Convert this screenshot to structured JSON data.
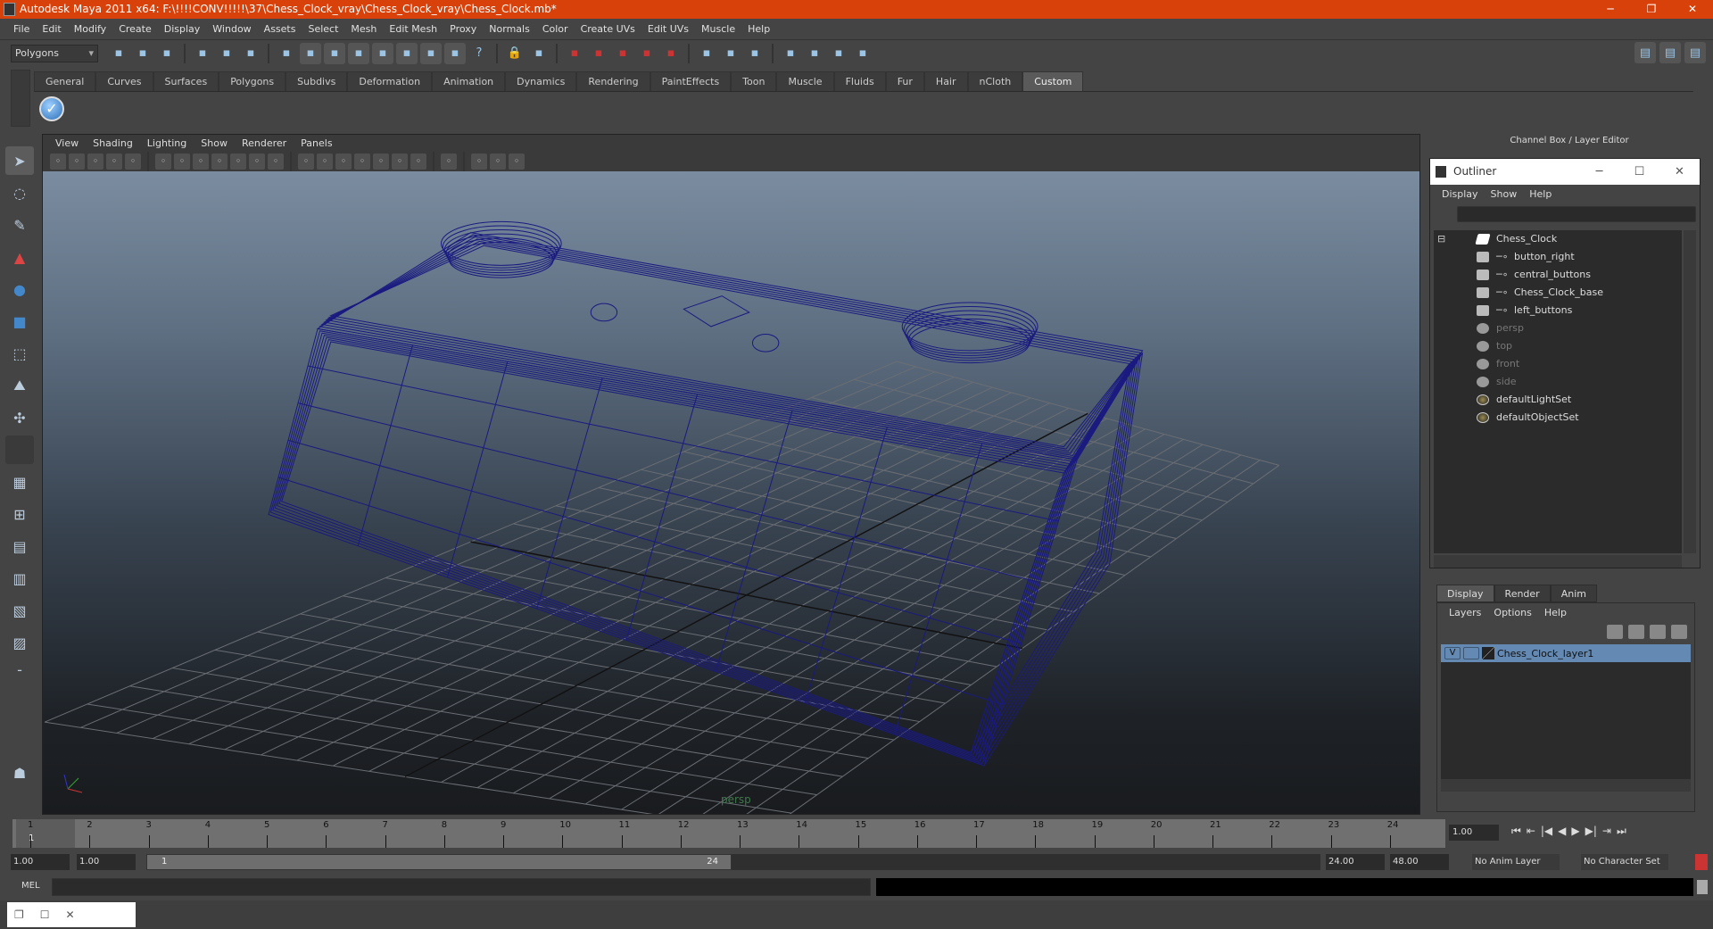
{
  "window": {
    "title": "Autodesk Maya 2011 x64: F:\\!!!!CONV!!!!!\\37\\Chess_Clock_vray\\Chess_Clock_vray\\Chess_Clock.mb*",
    "min": "─",
    "max": "❐",
    "close": "✕"
  },
  "menubar": [
    "File",
    "Edit",
    "Modify",
    "Create",
    "Display",
    "Window",
    "Assets",
    "Select",
    "Mesh",
    "Edit Mesh",
    "Proxy",
    "Normals",
    "Color",
    "Create UVs",
    "Edit UVs",
    "Muscle",
    "Help"
  ],
  "toolbar": {
    "mode": "Polygons",
    "icons": [
      "new-scene-icon",
      "open-scene-icon",
      "save-scene-icon",
      "|",
      "select-hierarchy-icon",
      "select-object-icon",
      "select-component-icon",
      "|",
      "lock-selection-icon",
      "snap-grid-icon",
      "snap-curve-icon",
      "snap-point-icon",
      "snap-view-plane-icon",
      "snap-live-icon",
      "snap-surface-icon",
      "snap-points-icon",
      "help-icon",
      "|",
      "lock-icon",
      "select-highlight-icon",
      "|",
      "magnet-grid-icon",
      "magnet-curve-icon",
      "magnet-point-icon",
      "magnet-plane-icon",
      "magnet-live-icon",
      "|",
      "input-ops-icon",
      "output-ops-icon",
      "history-icon",
      "|",
      "render-view-icon",
      "render-clapper-icon",
      "ipr-render-icon",
      "render-settings-icon"
    ],
    "right_icons": [
      "attribute-editor-icon",
      "tool-settings-icon",
      "channel-box-icon"
    ]
  },
  "shelf": {
    "tabs": [
      "General",
      "Curves",
      "Surfaces",
      "Polygons",
      "Subdivs",
      "Deformation",
      "Animation",
      "Dynamics",
      "Rendering",
      "PaintEffects",
      "Toon",
      "Muscle",
      "Fluids",
      "Fur",
      "Hair",
      "nCloth",
      "Custom"
    ],
    "active": "Custom"
  },
  "viewport": {
    "menus": [
      "View",
      "Shading",
      "Lighting",
      "Show",
      "Renderer",
      "Panels"
    ],
    "camera": "persp",
    "wire_color": "#1a1a80",
    "icons": [
      "camera-select-icon",
      "camera-attributes-icon",
      "bookmark-icon",
      "image-plane-icon",
      "two-d-pan-zoom-icon",
      "|",
      "grid-icon",
      "film-gate-icon",
      "resolution-gate-icon",
      "gate-mask-icon",
      "field-chart-icon",
      "safe-action-icon",
      "safe-title-icon",
      "|",
      "wireframe-icon",
      "smooth-shade-icon",
      "wireframe-on-shaded-icon",
      "textured-icon",
      "use-all-lights-icon",
      "shadows-icon",
      "default-material-icon",
      "|",
      "isolate-select-icon",
      "|",
      "xray-icon",
      "xray-joints-icon",
      "xray-components-icon"
    ]
  },
  "right_panel": {
    "header": "Channel Box / Layer Editor"
  },
  "outliner": {
    "title": "Outliner",
    "menus": [
      "Display",
      "Show",
      "Help"
    ],
    "items": [
      {
        "label": "Chess_Clock",
        "type": "group",
        "depth": 0,
        "dim": false
      },
      {
        "label": "button_right",
        "type": "mesh",
        "depth": 1,
        "dim": false
      },
      {
        "label": "central_buttons",
        "type": "mesh",
        "depth": 1,
        "dim": false
      },
      {
        "label": "Chess_Clock_base",
        "type": "mesh",
        "depth": 1,
        "dim": false
      },
      {
        "label": "left_buttons",
        "type": "mesh",
        "depth": 1,
        "dim": false
      },
      {
        "label": "persp",
        "type": "camera",
        "depth": 0,
        "dim": true
      },
      {
        "label": "top",
        "type": "camera",
        "depth": 0,
        "dim": true
      },
      {
        "label": "front",
        "type": "camera",
        "depth": 0,
        "dim": true
      },
      {
        "label": "side",
        "type": "camera",
        "depth": 0,
        "dim": true
      },
      {
        "label": "defaultLightSet",
        "type": "set",
        "depth": 0,
        "dim": false
      },
      {
        "label": "defaultObjectSet",
        "type": "set",
        "depth": 0,
        "dim": false
      }
    ]
  },
  "layer_editor": {
    "tabs": [
      "Display",
      "Render",
      "Anim"
    ],
    "active": "Display",
    "menus": [
      "Layers",
      "Options",
      "Help"
    ],
    "layer": {
      "visible": "V",
      "name": "Chess_Clock_layer1",
      "color": "#6489b2"
    }
  },
  "timeline": {
    "start": 1,
    "end": 24,
    "current_label": "1",
    "current_frame": "1.00"
  },
  "range": {
    "start": "1.00",
    "anim_start": "1.00",
    "slider_start": "1",
    "slider_end": "24",
    "end": "24.00",
    "anim_end": "48.00",
    "anim_layer": "No Anim Layer",
    "character_set": "No Character Set"
  },
  "playback": [
    "⏮",
    "⇤",
    "|◀",
    "◀",
    "▶",
    "▶|",
    "⇥",
    "⏭"
  ],
  "command": {
    "label": "MEL"
  }
}
